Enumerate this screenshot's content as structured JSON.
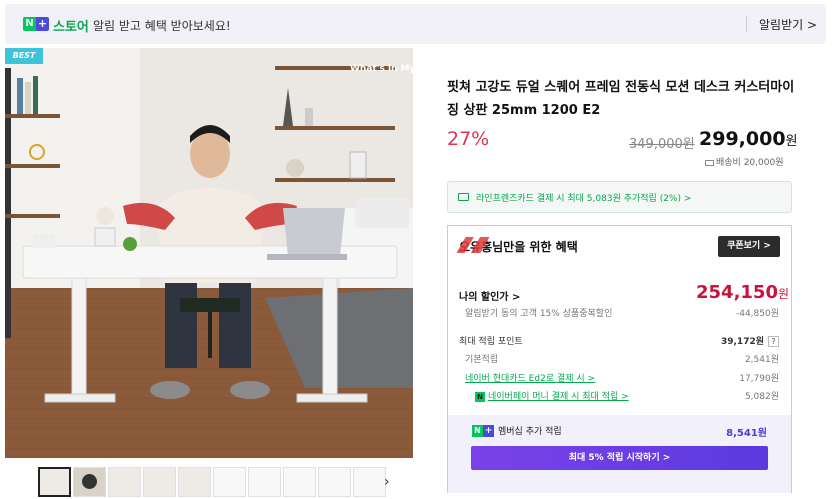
{
  "topbar": {
    "n": "N",
    "plus": "+",
    "store": "스토어",
    "promo": "알림 받고 혜택 받아보세요!",
    "alarm_button": "알림받기 >"
  },
  "gallery": {
    "best_badge": "BEST",
    "watermark": "What's in My Day",
    "thumb_count": 10,
    "next_arrow": "›"
  },
  "product": {
    "title": "핏쳐 고강도 듀얼 스퀘어 프레임 전동식 모션 데스크 커스터마이징 상판 25mm 1200 E2",
    "discount": "27%",
    "original_price": "349,000원",
    "price": "299,000",
    "price_unit": "원",
    "shipping": "배송비 20,000원",
    "card_promo": "라인프렌즈카드 결제 시 최대 5,083원 추가적립 (2%) >"
  },
  "benefit": {
    "heading": "오유홍님만을 위한 혜택",
    "coupon_button": "쿠폰보기 >",
    "my_discount_label": "나의 할인가 >",
    "my_discount_price": "254,150",
    "my_discount_unit": "원",
    "coupon_row_label": "알림받기 동의 고객 15% 상품중복할인",
    "coupon_row_value": "-44,850원",
    "points_label": "최대 적립 포인트",
    "points_value": "39,172원",
    "help": "?",
    "base_label": "기본적립",
    "base_value": "2,541원",
    "card_label": "네이버 현대카드 Ed2로 결제 시 >",
    "card_value": "17,790원",
    "npay_label": "네이버페이 머니 결제 시 최대 적립 >",
    "npay_value": "5,082원",
    "member_label": "멤버십 추가 적립",
    "member_value": "8,541원",
    "member_button": "최대 5% 적립 시작하기 >"
  }
}
